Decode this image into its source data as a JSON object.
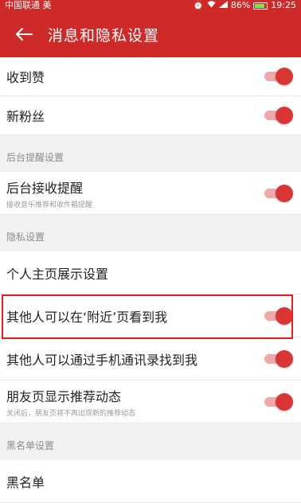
{
  "status_bar": {
    "carrier": "中国联通",
    "carrier_extra": "美",
    "battery": "86%",
    "time": "19:25",
    "icons": [
      "alarm-icon",
      "wifi-icon",
      "signal-icon",
      "battery-icon"
    ]
  },
  "header": {
    "title": "消息和隐私设置",
    "back_icon": "back-arrow-icon"
  },
  "rows_top": [
    {
      "label": "收到赞",
      "toggle": true
    },
    {
      "label": "新粉丝",
      "toggle": true
    }
  ],
  "section_background": {
    "title": "后台提醒设置",
    "row": {
      "label": "后台接收提醒",
      "sub": "接收音乐推荐和收件箱提醒",
      "toggle": true
    }
  },
  "section_privacy": {
    "title": "隐私设置",
    "rows": [
      {
        "label": "个人主页展示设置"
      },
      {
        "label": "其他人可以在‘附近’页看到我",
        "toggle": true
      },
      {
        "label": "其他人可以通过手机通讯录找到我",
        "toggle": true
      },
      {
        "label": "朋友页显示推荐动态",
        "sub": "关闭后，朋友页将不再出现新的推荐动态",
        "toggle": true
      }
    ]
  },
  "section_blacklist": {
    "title": "黑名单设置",
    "rows": [
      {
        "label": "黑名单"
      }
    ]
  },
  "colors": {
    "accent": "#cf2a2a",
    "toggle_on": "#d93535",
    "highlight": "#e22222"
  }
}
